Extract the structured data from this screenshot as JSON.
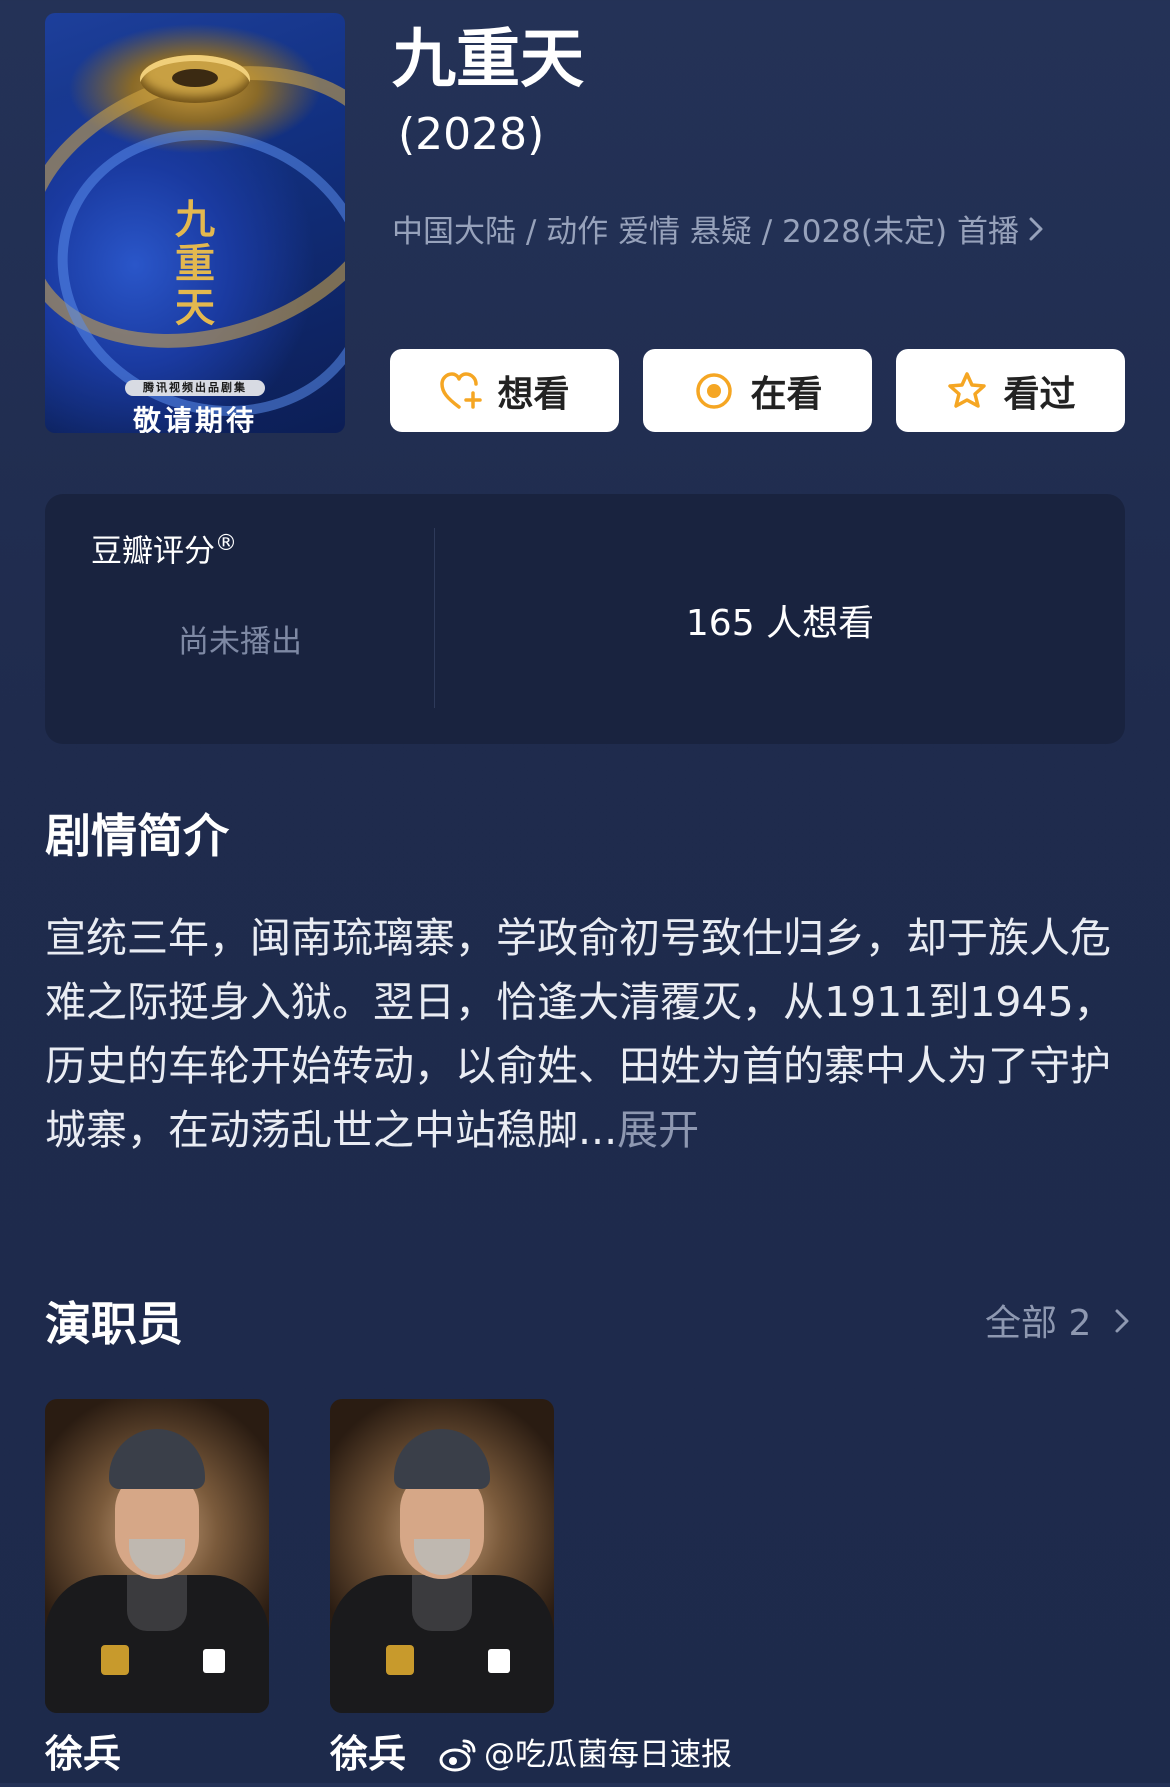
{
  "poster": {
    "vertical_title": "九重天",
    "producer_chip": "腾讯视频出品剧集",
    "tagline": "敬请期待"
  },
  "header": {
    "title": "九重天",
    "year": "(2028)",
    "meta": "中国大陆 / 动作 爱情 悬疑 / 2028(未定) 首播"
  },
  "actions": {
    "want": "想看",
    "watching": "在看",
    "watched": "看过"
  },
  "rating": {
    "label": "豆瓣评分",
    "registered": "®",
    "status": "尚未播出",
    "want_count": "165 人想看"
  },
  "synopsis": {
    "heading": "剧情简介",
    "text": "宣统三年，闽南琉璃寨，学政俞初号致仕归乡，却于族人危难之际挺身入狱。翌日，恰逢大清覆灭，从1911到1945，历史的车轮开始转动，以俞姓、田姓为首的寨中人为了守护城寨，在动荡乱世之中站稳脚...",
    "expand": "展开"
  },
  "cast": {
    "heading": "演职员",
    "all_label": "全部 2",
    "members": [
      {
        "name": "徐兵"
      },
      {
        "name": "徐兵"
      }
    ]
  },
  "watermark": {
    "text": "@吃瓜菌每日速报"
  },
  "colors": {
    "background": "#223056",
    "card": "#19233f",
    "accent_orange": "#f5a623",
    "muted_text": "#97a2bb"
  }
}
